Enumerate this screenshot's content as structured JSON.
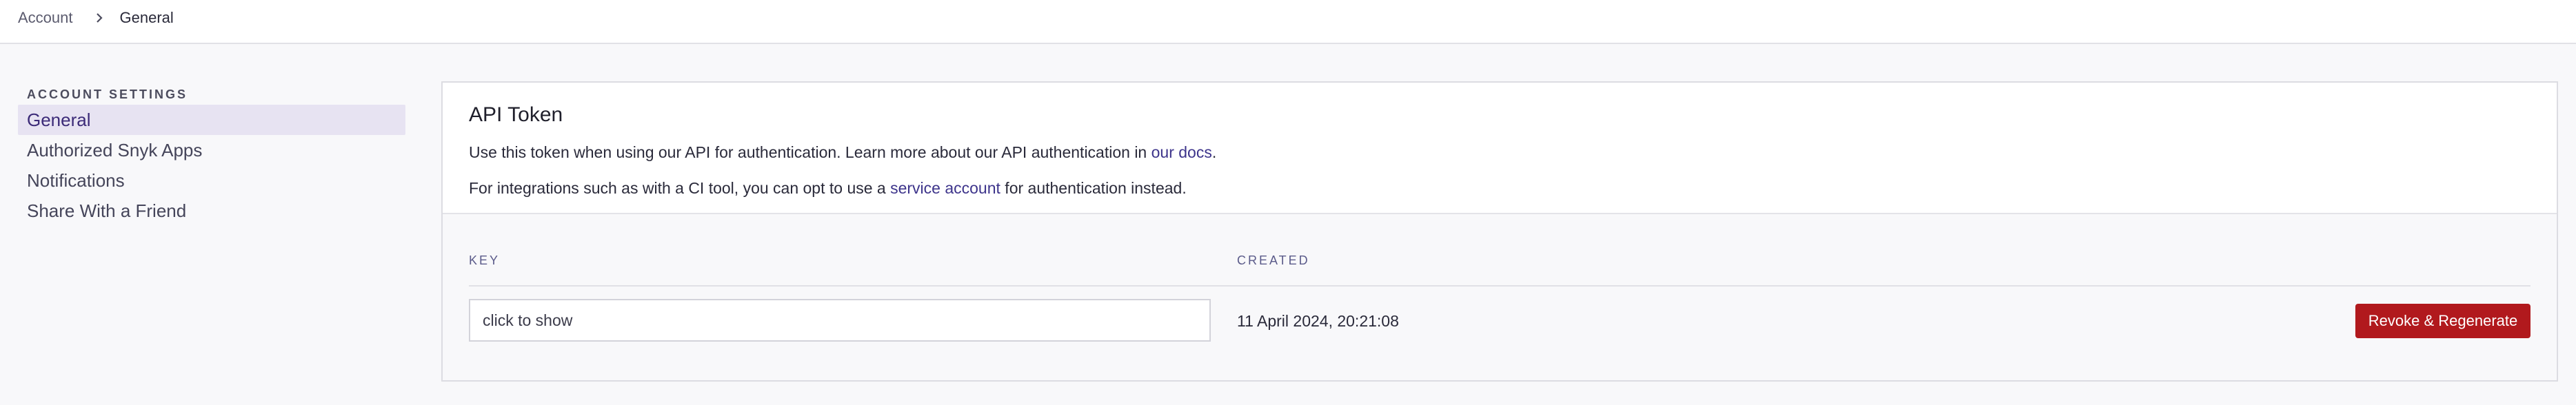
{
  "breadcrumb": {
    "parent": "Account",
    "separator_icon": "chevron-right-icon",
    "current": "General"
  },
  "sidebar": {
    "heading": "ACCOUNT SETTINGS",
    "items": [
      {
        "label": "General",
        "active": true
      },
      {
        "label": "Authorized Snyk Apps",
        "active": false
      },
      {
        "label": "Notifications",
        "active": false
      },
      {
        "label": "Share With a Friend",
        "active": false
      }
    ]
  },
  "api_token": {
    "title": "API Token",
    "description_1_before": "Use this token when using our API for authentication. Learn more about our API authentication in ",
    "description_1_link": "our docs",
    "description_1_after": ".",
    "description_2_before": "For integrations such as with a CI tool, you can opt to use a ",
    "description_2_link": "service account",
    "description_2_after": " for authentication instead.",
    "key_header": "KEY",
    "created_header": "CREATED",
    "key_placeholder": "click to show",
    "created_value": "11 April 2024, 20:21:08",
    "revoke_button": "Revoke & Regenerate"
  },
  "colors": {
    "accent": "#3d348b",
    "danger": "#b1191d",
    "active_bg": "#e7e3f2"
  }
}
